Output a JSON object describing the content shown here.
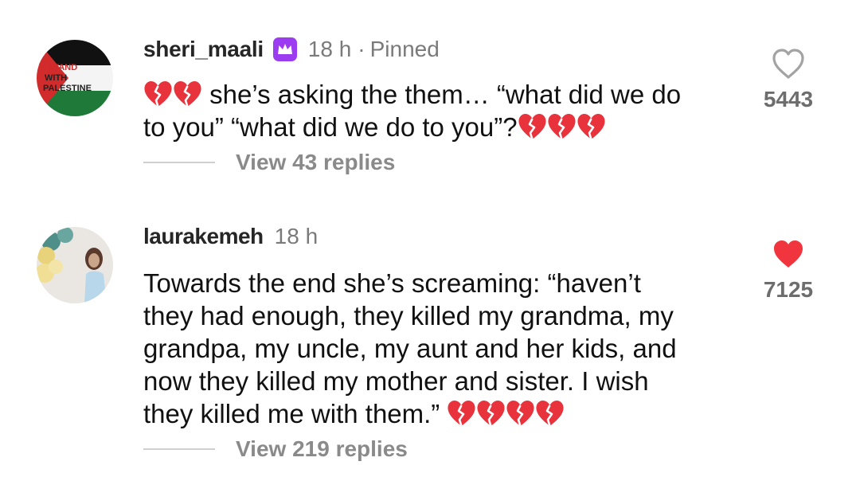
{
  "comments": [
    {
      "username": "sheri_maali",
      "time": "18 h",
      "dot": "·",
      "pinned": "Pinned",
      "avatar_text": [
        "I STAND",
        "WITH",
        "PALESTINE"
      ],
      "line1": "she’s asking the them… “what did we do",
      "line2": "to you” “what did we do to you”?",
      "replies": "View 43 replies",
      "likes": "5443",
      "liked": false,
      "badge_color": "#9b3cf0"
    },
    {
      "username": "laurakemeh",
      "time": "18 h",
      "lines": [
        "Towards the end she’s screaming: “haven’t",
        "they had enough, they killed my grandma, my",
        "grandpa, my uncle, my aunt and her kids, and",
        "now they killed my mother and sister. I wish",
        "they killed me with them.”"
      ],
      "replies": "View 219 replies",
      "likes": "7125",
      "liked": true
    }
  ],
  "colors": {
    "like_active": "#f0353f",
    "like_inactive": "#262626",
    "broken_heart": "#e8323c"
  }
}
